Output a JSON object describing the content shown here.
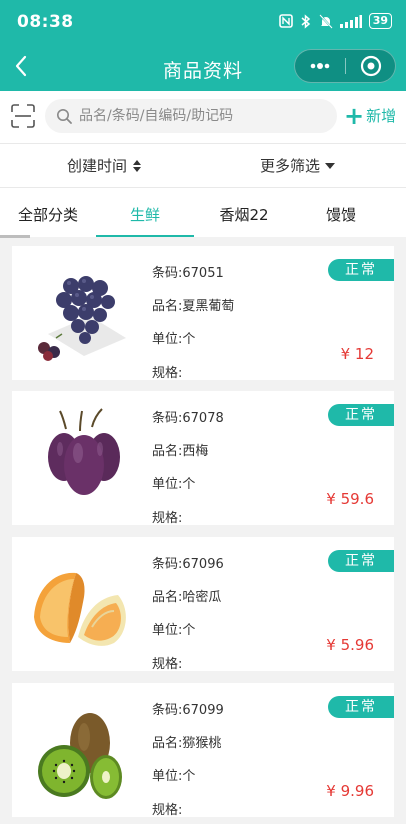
{
  "status_bar": {
    "time": "08:38",
    "battery": "39"
  },
  "nav": {
    "title": "商品资料"
  },
  "search": {
    "placeholder": "品名/条码/自编码/助记码",
    "add_label": "新增"
  },
  "filters": {
    "sort_label": "创建时间",
    "more_label": "更多筛选"
  },
  "tabs": [
    {
      "label": "全部分类"
    },
    {
      "label": "生鲜"
    },
    {
      "label": "香烟22"
    },
    {
      "label": "馒馒"
    }
  ],
  "active_tab": 1,
  "products": [
    {
      "barcode": "条码:67051",
      "name": "品名:夏黑葡萄",
      "unit": "单位:个",
      "spec": "规格:",
      "status": "正常",
      "price": "¥ 12",
      "icon": "grape-image"
    },
    {
      "barcode": "条码:67078",
      "name": "品名:西梅",
      "unit": "单位:个",
      "spec": "规格:",
      "status": "正常",
      "price": "¥ 59.6",
      "icon": "plum-image"
    },
    {
      "barcode": "条码:67096",
      "name": "品名:哈密瓜",
      "unit": "单位:个",
      "spec": "规格:",
      "status": "正常",
      "price": "¥ 5.96",
      "icon": "cantaloupe-image"
    },
    {
      "barcode": "条码:67099",
      "name": "品名:猕猴桃",
      "unit": "单位:个",
      "spec": "规格:",
      "status": "正常",
      "price": "¥ 9.96",
      "icon": "kiwi-image"
    }
  ],
  "colors": {
    "primary": "#1fb9a9",
    "price": "#e53935",
    "background": "#f2f2f2"
  }
}
